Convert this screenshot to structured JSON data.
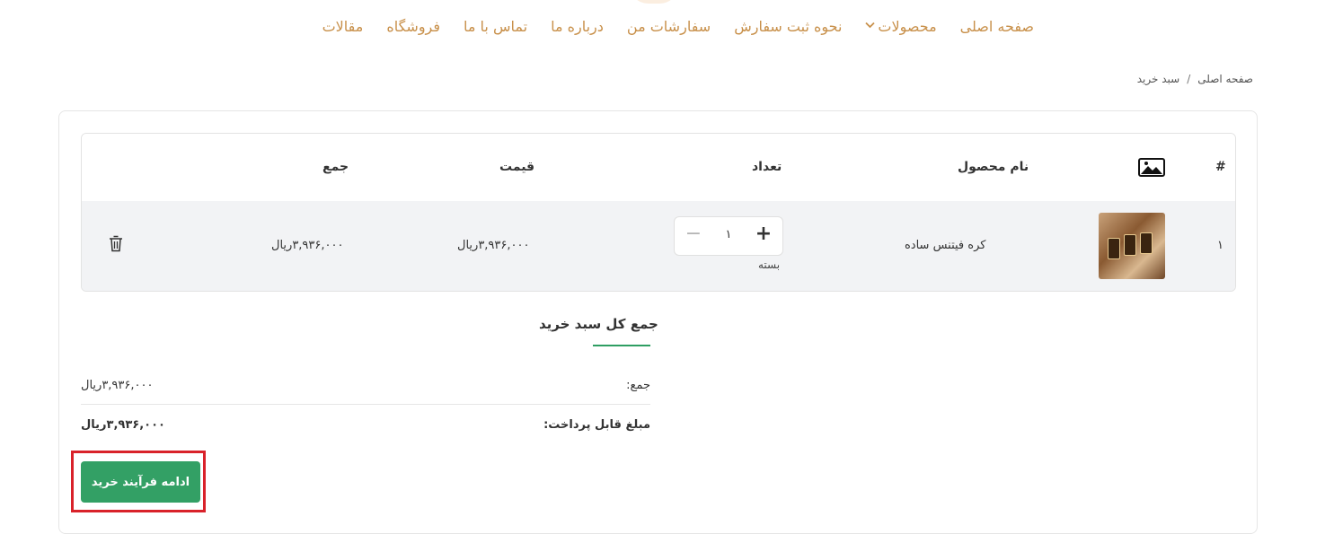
{
  "nav": {
    "items": [
      "صفحه اصلی",
      "محصولات",
      "نحوه ثبت سفارش",
      "سفارشات من",
      "درباره ما",
      "تماس با ما",
      "فروشگاه",
      "مقالات"
    ]
  },
  "breadcrumb": {
    "home": "صفحه اصلی",
    "separator": "/",
    "current": "سبد خرید"
  },
  "table": {
    "headers": {
      "index": "#",
      "image_icon": "image-icon",
      "name": "نام محصول",
      "quantity": "تعداد",
      "price": "قیمت",
      "total": "جمع"
    },
    "rows": [
      {
        "index": "۱",
        "name": "کره فیتنس ساده",
        "quantity": "۱",
        "unit": "بسته",
        "price": "۳,۹۳۶,۰۰۰ریال",
        "total": "۳,۹۳۶,۰۰۰ریال"
      }
    ]
  },
  "summary": {
    "title": "جمع کل سبد خرید",
    "subtotal_label": "جمع:",
    "subtotal_value": "۳,۹۳۶,۰۰۰ریال",
    "payable_label": "مبلغ قابل پرداخت:",
    "payable_value": "۳,۹۳۶,۰۰۰ریال"
  },
  "checkout": {
    "label": "ادامه فرآیند خرید"
  },
  "colors": {
    "nav": "#c8904a",
    "accent": "#33a065",
    "highlight": "#d9222a"
  }
}
